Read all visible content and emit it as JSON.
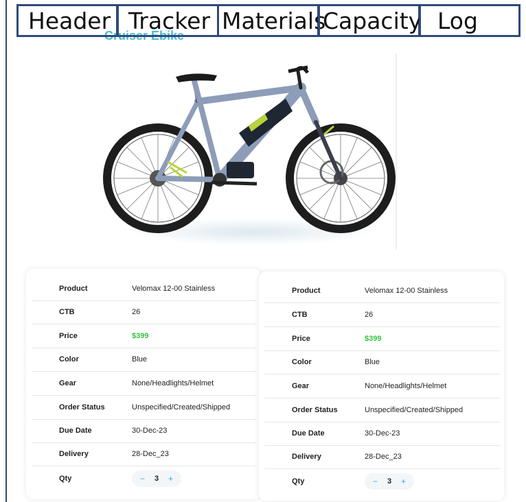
{
  "tabs": [
    "Header",
    "Tracker",
    "Materials",
    "Capacity",
    "Log"
  ],
  "product_title": "Cruiser Ebike",
  "colors": {
    "frame": "#8d9db8",
    "accent": "#b7d43a",
    "price": "#34c240",
    "tab_border": "#2f4a7a"
  },
  "cards": [
    {
      "rows": [
        {
          "label": "Product",
          "value": "Velomax 12-00 Stainless"
        },
        {
          "label": "CTB",
          "value": "26"
        },
        {
          "label": "Price",
          "value": "$399"
        },
        {
          "label": "Color",
          "value": "Blue"
        },
        {
          "label": "Gear",
          "value": "None/Headlights/Helmet"
        },
        {
          "label": "Order Status",
          "value": "Unspecified/Created/Shipped"
        },
        {
          "label": "Due Date",
          "value": "30-Dec-23"
        },
        {
          "label": "Delivery",
          "value": "28-Dec_23"
        },
        {
          "label": "Qty",
          "value": "3",
          "minus": "−",
          "plus": "+"
        }
      ]
    },
    {
      "rows": [
        {
          "label": "Product",
          "value": "Velomax 12-00 Stainless"
        },
        {
          "label": "CTB",
          "value": "26"
        },
        {
          "label": "Price",
          "value": "$399"
        },
        {
          "label": "Color",
          "value": "Blue"
        },
        {
          "label": "Gear",
          "value": "None/Headlights/Helmet"
        },
        {
          "label": "Order Status",
          "value": "Unspecified/Created/Shipped"
        },
        {
          "label": "Due Date",
          "value": "30-Dec-23"
        },
        {
          "label": "Delivery",
          "value": "28-Dec_23"
        },
        {
          "label": "Qty",
          "value": "3",
          "minus": "−",
          "plus": "+"
        }
      ]
    }
  ]
}
